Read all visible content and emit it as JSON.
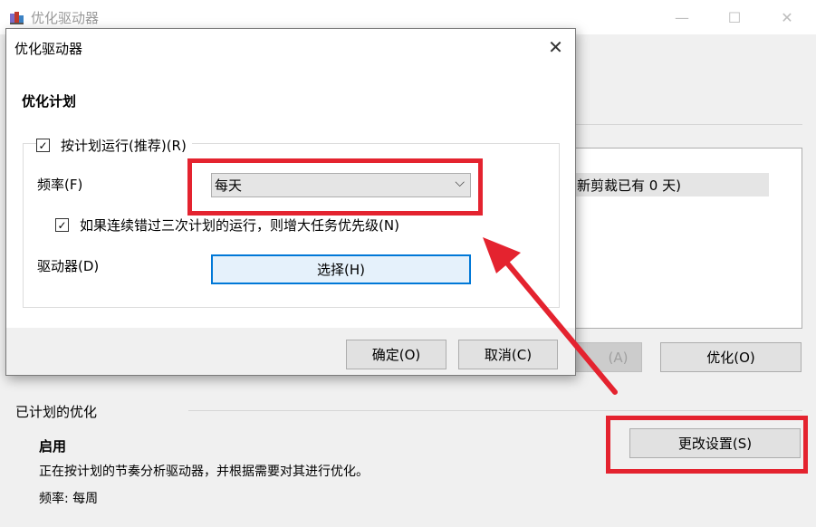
{
  "background_window": {
    "title": "优化驱动器",
    "drive_list_row_text": "新剪裁已有 0 天)",
    "analyze_button_label": "(A)",
    "optimize_button_label": "优化(O)",
    "scheduled_section_heading": "已计划的优化",
    "status_title": "启用",
    "status_description": "正在按计划的节奏分析驱动器，并根据需要对其进行优化。",
    "frequency_status": "频率: 每周",
    "change_settings_button_label": "更改设置(S)"
  },
  "dialog": {
    "title": "优化驱动器",
    "section_title": "优化计划",
    "run_on_schedule_label": "按计划运行(推荐)(R)",
    "run_on_schedule_checked": true,
    "frequency_label": "频率(F)",
    "frequency_value": "每天",
    "increase_priority_label": "如果连续错过三次计划的运行，则增大任务优先级(N)",
    "increase_priority_checked": true,
    "drives_label": "驱动器(D)",
    "select_button_label": "选择(H)",
    "ok_button_label": "确定(O)",
    "cancel_button_label": "取消(C)"
  },
  "icons": {
    "checkmark": "✓",
    "chevron_down": "⌵",
    "close": "✕",
    "minimize": "—",
    "maximize": "☐"
  },
  "colors": {
    "annotation_red": "#e4232f",
    "focus_blue": "#0078d7"
  }
}
